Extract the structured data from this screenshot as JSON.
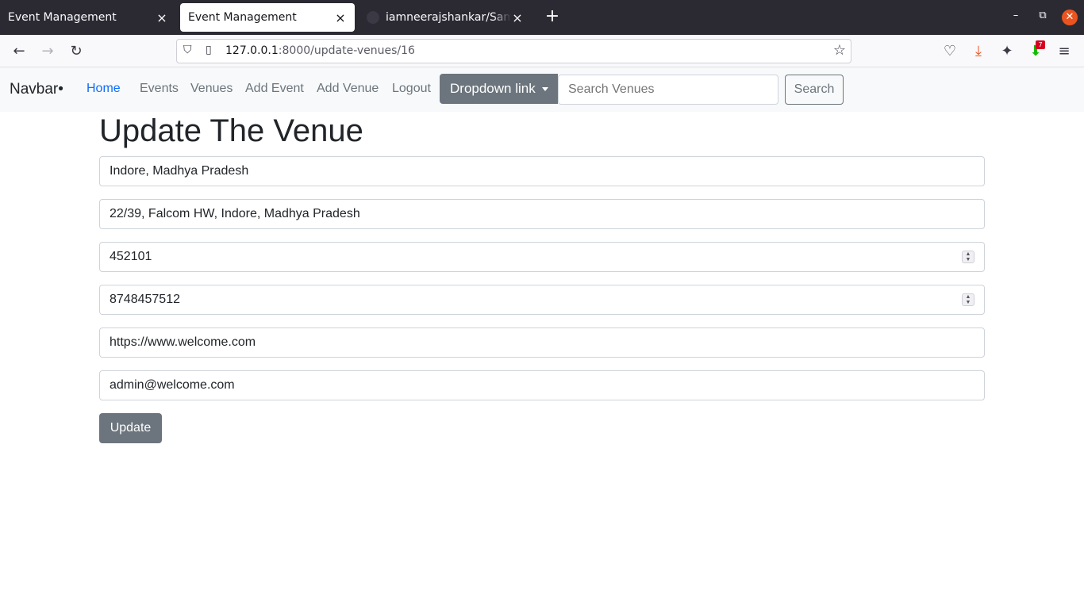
{
  "browser": {
    "tabs": [
      {
        "title": "Event Management",
        "close": "×"
      },
      {
        "title": "Event Management",
        "close": "×"
      },
      {
        "title": "iamneerajshankar/Sample",
        "close": "×"
      }
    ],
    "new_tab": "+",
    "url_host": "127.0.0.1",
    "url_rest": ":8000/update-venues/16",
    "downloads_badge": "7"
  },
  "navbar": {
    "brand": "Navbar•",
    "links": [
      "Home",
      "Events",
      "Venues",
      "Add Event",
      "Add Venue",
      "Logout"
    ],
    "dropdown": "Dropdown link",
    "search_placeholder": "Search Venues",
    "search_button": "Search"
  },
  "form": {
    "title": "Update The Venue",
    "fields": [
      {
        "value": "Indore, Madhya Pradesh"
      },
      {
        "value": "22/39, Falcom HW, Indore, Madhya Pradesh"
      },
      {
        "value": "452101",
        "type": "number"
      },
      {
        "value": "8748457512",
        "type": "number"
      },
      {
        "value": "https://www.welcome.com"
      },
      {
        "value": "admin@welcome.com"
      }
    ],
    "submit": "Update"
  },
  "colors": {
    "primary": "#0d6efd",
    "secondary": "#6c757d",
    "navbar_bg": "#f8f9fa",
    "tabbar_bg": "#2b2a33"
  }
}
